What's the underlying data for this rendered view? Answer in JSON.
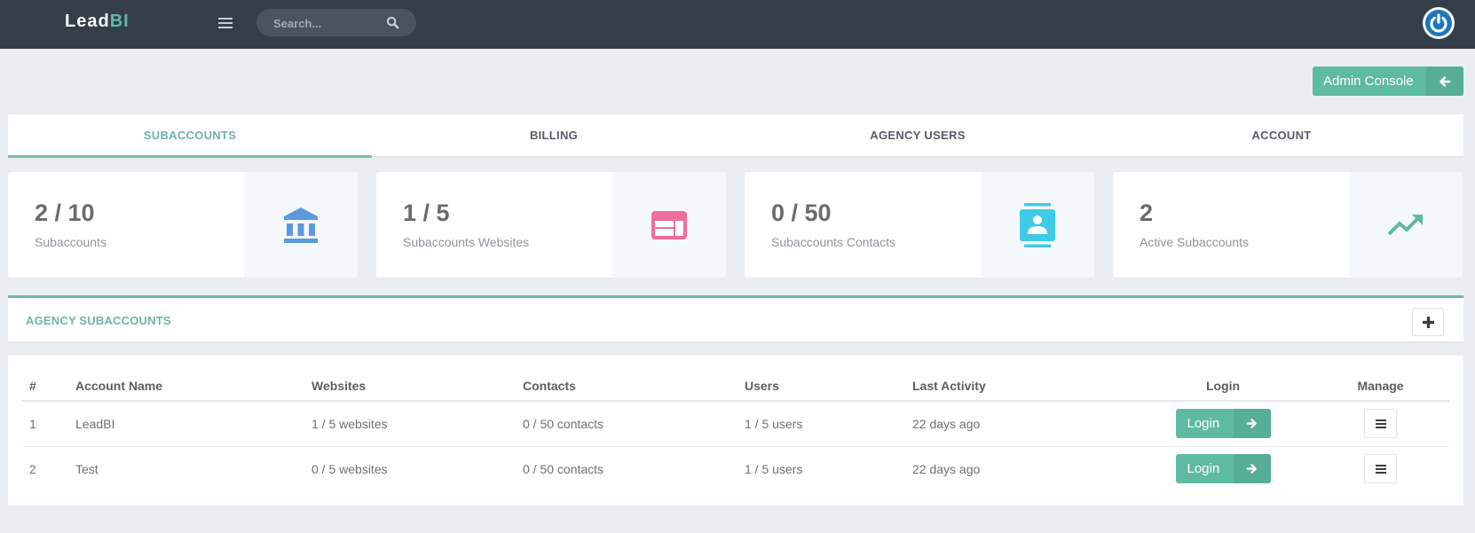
{
  "header": {
    "brand_main": "Lead",
    "brand_accent": "BI",
    "search_placeholder": "Search...",
    "icons": {
      "menu": "hamburger-icon",
      "search": "search-icon",
      "power": "power-icon"
    }
  },
  "admin_console": {
    "label": "Admin Console",
    "icon": "arrow-left-icon"
  },
  "tabs": [
    {
      "label": "SUBACCOUNTS",
      "active": true
    },
    {
      "label": "BILLING",
      "active": false
    },
    {
      "label": "AGENCY USERS",
      "active": false
    },
    {
      "label": "ACCOUNT",
      "active": false
    }
  ],
  "stats": [
    {
      "value": "2 / 10",
      "label": "Subaccounts",
      "icon": "bank-icon",
      "color": "#5b9ae0"
    },
    {
      "value": "1 / 5",
      "label": "Subaccounts Websites",
      "icon": "website-layout-icon",
      "color": "#f06c9b"
    },
    {
      "value": "0 / 50",
      "label": "Subaccounts Contacts",
      "icon": "contact-card-icon",
      "color": "#3fcbe6"
    },
    {
      "value": "2",
      "label": "Active Subaccounts",
      "icon": "trending-up-icon",
      "color": "#5fb9a3"
    }
  ],
  "section": {
    "title": "AGENCY SUBACCOUNTS",
    "add_icon": "plus-icon"
  },
  "table": {
    "columns": [
      "#",
      "Account Name",
      "Websites",
      "Contacts",
      "Users",
      "Last Activity",
      "Login",
      "Manage"
    ],
    "rows": [
      {
        "num": "1",
        "name": "LeadBI",
        "websites": "1 / 5 websites",
        "contacts": "0 / 50 contacts",
        "users": "1 / 5 users",
        "last_activity": "22 days ago",
        "login_label": "Login"
      },
      {
        "num": "2",
        "name": "Test",
        "websites": "0 / 5 websites",
        "contacts": "0 / 50 contacts",
        "users": "1 / 5 users",
        "last_activity": "22 days ago",
        "login_label": "Login"
      }
    ]
  },
  "colors": {
    "accent": "#5fbaa2",
    "topbar": "#343e48",
    "background": "#ebeef0"
  }
}
